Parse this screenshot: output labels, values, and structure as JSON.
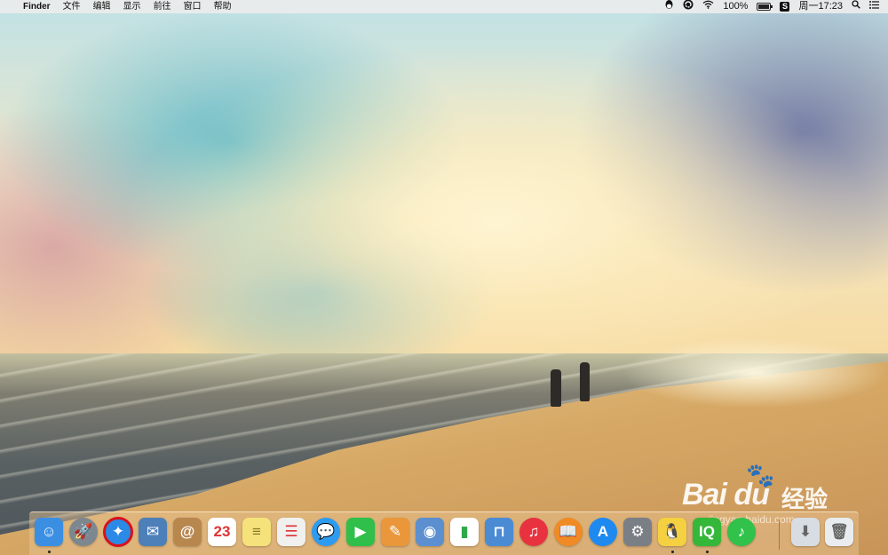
{
  "menubar": {
    "apple_glyph": "",
    "app_name": "Finder",
    "menus": [
      "文件",
      "编辑",
      "显示",
      "前往",
      "窗口",
      "帮助"
    ],
    "status": {
      "battery_percent_label": "100%",
      "battery_level": 1.0,
      "clock": "周一17:23",
      "s_icon_label": "S"
    }
  },
  "dock": {
    "apps": [
      {
        "name": "Finder",
        "icon": "finder-icon",
        "glyph": "☺",
        "color": "#3b8fe3",
        "running": true
      },
      {
        "name": "Launchpad",
        "icon": "rocket-icon",
        "glyph": "🚀",
        "color": "#7d8790",
        "running": false
      },
      {
        "name": "Safari",
        "icon": "compass-icon",
        "glyph": "✦",
        "color": "#2a8ae6",
        "running": false,
        "highlighted": true
      },
      {
        "name": "Mail",
        "icon": "stamp-icon",
        "glyph": "✉",
        "color": "#4d7fb8",
        "running": false
      },
      {
        "name": "Contacts",
        "icon": "contacts-book-icon",
        "glyph": "@",
        "color": "#b8874e",
        "running": false
      },
      {
        "name": "Calendar",
        "icon": "calendar-icon",
        "glyph": "23",
        "color": "#ffffff",
        "running": false
      },
      {
        "name": "Notes",
        "icon": "notes-icon",
        "glyph": "≡",
        "color": "#f5e27a",
        "running": false
      },
      {
        "name": "Reminders",
        "icon": "reminders-icon",
        "glyph": "☰",
        "color": "#f0f0ee",
        "running": false
      },
      {
        "name": "Messages",
        "icon": "messages-icon",
        "glyph": "💬",
        "color": "#2d9cf0",
        "running": false
      },
      {
        "name": "FaceTime",
        "icon": "facetime-icon",
        "glyph": "▶",
        "color": "#2fbf4a",
        "running": false
      },
      {
        "name": "Pages",
        "icon": "pages-icon",
        "glyph": "✎",
        "color": "#e9973a",
        "running": false
      },
      {
        "name": "Photo Booth",
        "icon": "photos-icon",
        "glyph": "◉",
        "color": "#5b8fcf",
        "running": false
      },
      {
        "name": "Numbers",
        "icon": "numbers-chart-icon",
        "glyph": "▮",
        "color": "#ffffff",
        "running": false
      },
      {
        "name": "Keynote",
        "icon": "keynote-icon",
        "glyph": "⊓",
        "color": "#4a8bd4",
        "running": false
      },
      {
        "name": "iTunes",
        "icon": "music-note-icon",
        "glyph": "♫",
        "color": "#e8323f",
        "running": false
      },
      {
        "name": "iBooks",
        "icon": "book-icon",
        "glyph": "📖",
        "color": "#f08a24",
        "running": false
      },
      {
        "name": "App Store",
        "icon": "app-store-icon",
        "glyph": "A",
        "color": "#1e8af0",
        "running": false
      },
      {
        "name": "System Preferences",
        "icon": "gear-icon",
        "glyph": "⚙",
        "color": "#7a7f86",
        "running": false
      },
      {
        "name": "QQ",
        "icon": "penguin-icon",
        "glyph": "🐧",
        "color": "#f5d040",
        "running": true
      },
      {
        "name": "iQIYI",
        "icon": "iqiyi-icon",
        "glyph": "IQ",
        "color": "#35b73a",
        "running": true
      },
      {
        "name": "QQ Music",
        "icon": "qq-music-icon",
        "glyph": "♪",
        "color": "#30c24a",
        "running": false
      }
    ],
    "right_items": [
      {
        "name": "Downloads",
        "icon": "downloads-folder-icon",
        "glyph": "⬇",
        "color": "#d8dde3"
      },
      {
        "name": "Trash",
        "icon": "trash-icon",
        "glyph": "🗑",
        "color": "#e9ecef"
      }
    ]
  },
  "watermark": {
    "brand": "Bai du",
    "product": "经验",
    "url": "jingyan.baidu.com"
  }
}
